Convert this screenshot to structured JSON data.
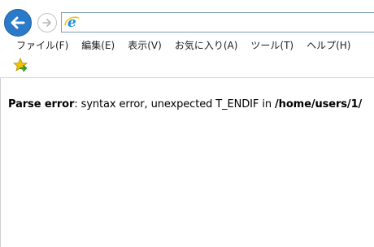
{
  "menu": {
    "items": [
      {
        "label": "ファイル(F)"
      },
      {
        "label": "編集(E)"
      },
      {
        "label": "表示(V)"
      },
      {
        "label": "お気に入り(A)"
      },
      {
        "label": "ツール(T)"
      },
      {
        "label": "ヘルプ(H)"
      }
    ]
  },
  "address": {
    "value": ""
  },
  "error": {
    "label": "Parse error",
    "separator": ":",
    "message": " syntax error, unexpected T_ENDIF in ",
    "path": "/home/users/1/"
  },
  "icons": {
    "back": "back-arrow-icon",
    "forward": "forward-arrow-icon",
    "page": "ie-logo-icon",
    "favorites": "add-favorites-icon"
  },
  "colors": {
    "back_button": "#2b79c9",
    "ie_logo": "#1e8fd8",
    "favorites_star": "#f2c200",
    "favorites_arrow": "#3c9a2a"
  }
}
